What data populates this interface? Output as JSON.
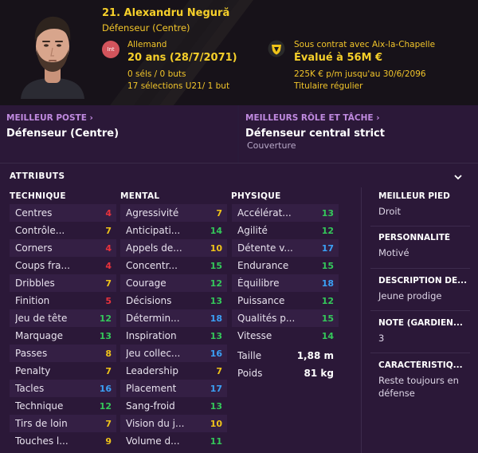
{
  "player": {
    "name": "21. Alexandru Negură",
    "position": "Défenseur (Centre)",
    "nationality_badge": "Int",
    "nationality": "Allemand",
    "age": "20 ans (28/7/2071)",
    "caps": "0 séls / 0 buts",
    "u21": "17 sélections U21/ 1 but",
    "contract": "Sous contrat avec Aix-la-Chapelle",
    "value": "Évalué à 56M €",
    "wage": "225K € p/m jusqu'au 30/6/2096",
    "status": "Titulaire régulier"
  },
  "best_position": {
    "label": "MEILLEUR POSTE",
    "value": "Défenseur (Centre)"
  },
  "best_role": {
    "label": "MEILLEURS RÔLE ET TÂCHE",
    "value": "Défenseur central strict",
    "duty": "Couverture"
  },
  "attributes": {
    "title": "ATTRIBUTS",
    "technical_title": "TECHNIQUE",
    "mental_title": "MENTAL",
    "physical_title": "PHYSIQUE",
    "technical": [
      {
        "name": "Centres",
        "value": 4
      },
      {
        "name": "Contrôle...",
        "value": 7
      },
      {
        "name": "Corners",
        "value": 4
      },
      {
        "name": "Coups fra...",
        "value": 4
      },
      {
        "name": "Dribbles",
        "value": 7
      },
      {
        "name": "Finition",
        "value": 5
      },
      {
        "name": "Jeu de tête",
        "value": 12
      },
      {
        "name": "Marquage",
        "value": 13
      },
      {
        "name": "Passes",
        "value": 8
      },
      {
        "name": "Penalty",
        "value": 7
      },
      {
        "name": "Tacles",
        "value": 16
      },
      {
        "name": "Technique",
        "value": 12
      },
      {
        "name": "Tirs de loin",
        "value": 7
      },
      {
        "name": "Touches l...",
        "value": 9
      }
    ],
    "mental": [
      {
        "name": "Agressivité",
        "value": 7
      },
      {
        "name": "Anticipati...",
        "value": 14
      },
      {
        "name": "Appels de...",
        "value": 10
      },
      {
        "name": "Concentr...",
        "value": 15
      },
      {
        "name": "Courage",
        "value": 12
      },
      {
        "name": "Décisions",
        "value": 13
      },
      {
        "name": "Détermin...",
        "value": 18
      },
      {
        "name": "Inspiration",
        "value": 13
      },
      {
        "name": "Jeu collec...",
        "value": 16
      },
      {
        "name": "Leadership",
        "value": 7
      },
      {
        "name": "Placement",
        "value": 17
      },
      {
        "name": "Sang-froid",
        "value": 13
      },
      {
        "name": "Vision du j...",
        "value": 10
      },
      {
        "name": "Volume d...",
        "value": 11
      }
    ],
    "physical": [
      {
        "name": "Accélérat...",
        "value": 13
      },
      {
        "name": "Agilité",
        "value": 12
      },
      {
        "name": "Détente v...",
        "value": 17
      },
      {
        "name": "Endurance",
        "value": 15
      },
      {
        "name": "Équilibre",
        "value": 18
      },
      {
        "name": "Puissance",
        "value": 12
      },
      {
        "name": "Qualités p...",
        "value": 15
      },
      {
        "name": "Vitesse",
        "value": 14
      }
    ],
    "height_label": "Taille",
    "height_value": "1,88 m",
    "weight_label": "Poids",
    "weight_value": "81 kg"
  },
  "side": {
    "foot_label": "MEILLEUR PIED",
    "foot_value": "Droit",
    "personality_label": "PERSONNALITÉ",
    "personality_value": "Motivé",
    "description_label": "DESCRIPTION DE...",
    "description_value": "Jeune prodige",
    "gk_rating_label": "NOTE (GARDIEN...",
    "gk_rating_value": "3",
    "trait_label": "CARACTÉRISTIQ...",
    "trait_value": "Reste toujours en défense"
  },
  "colors": {
    "low": "#e8323c",
    "mid": "#f0c419",
    "good": "#34c85a",
    "high": "#3ba0f5"
  }
}
